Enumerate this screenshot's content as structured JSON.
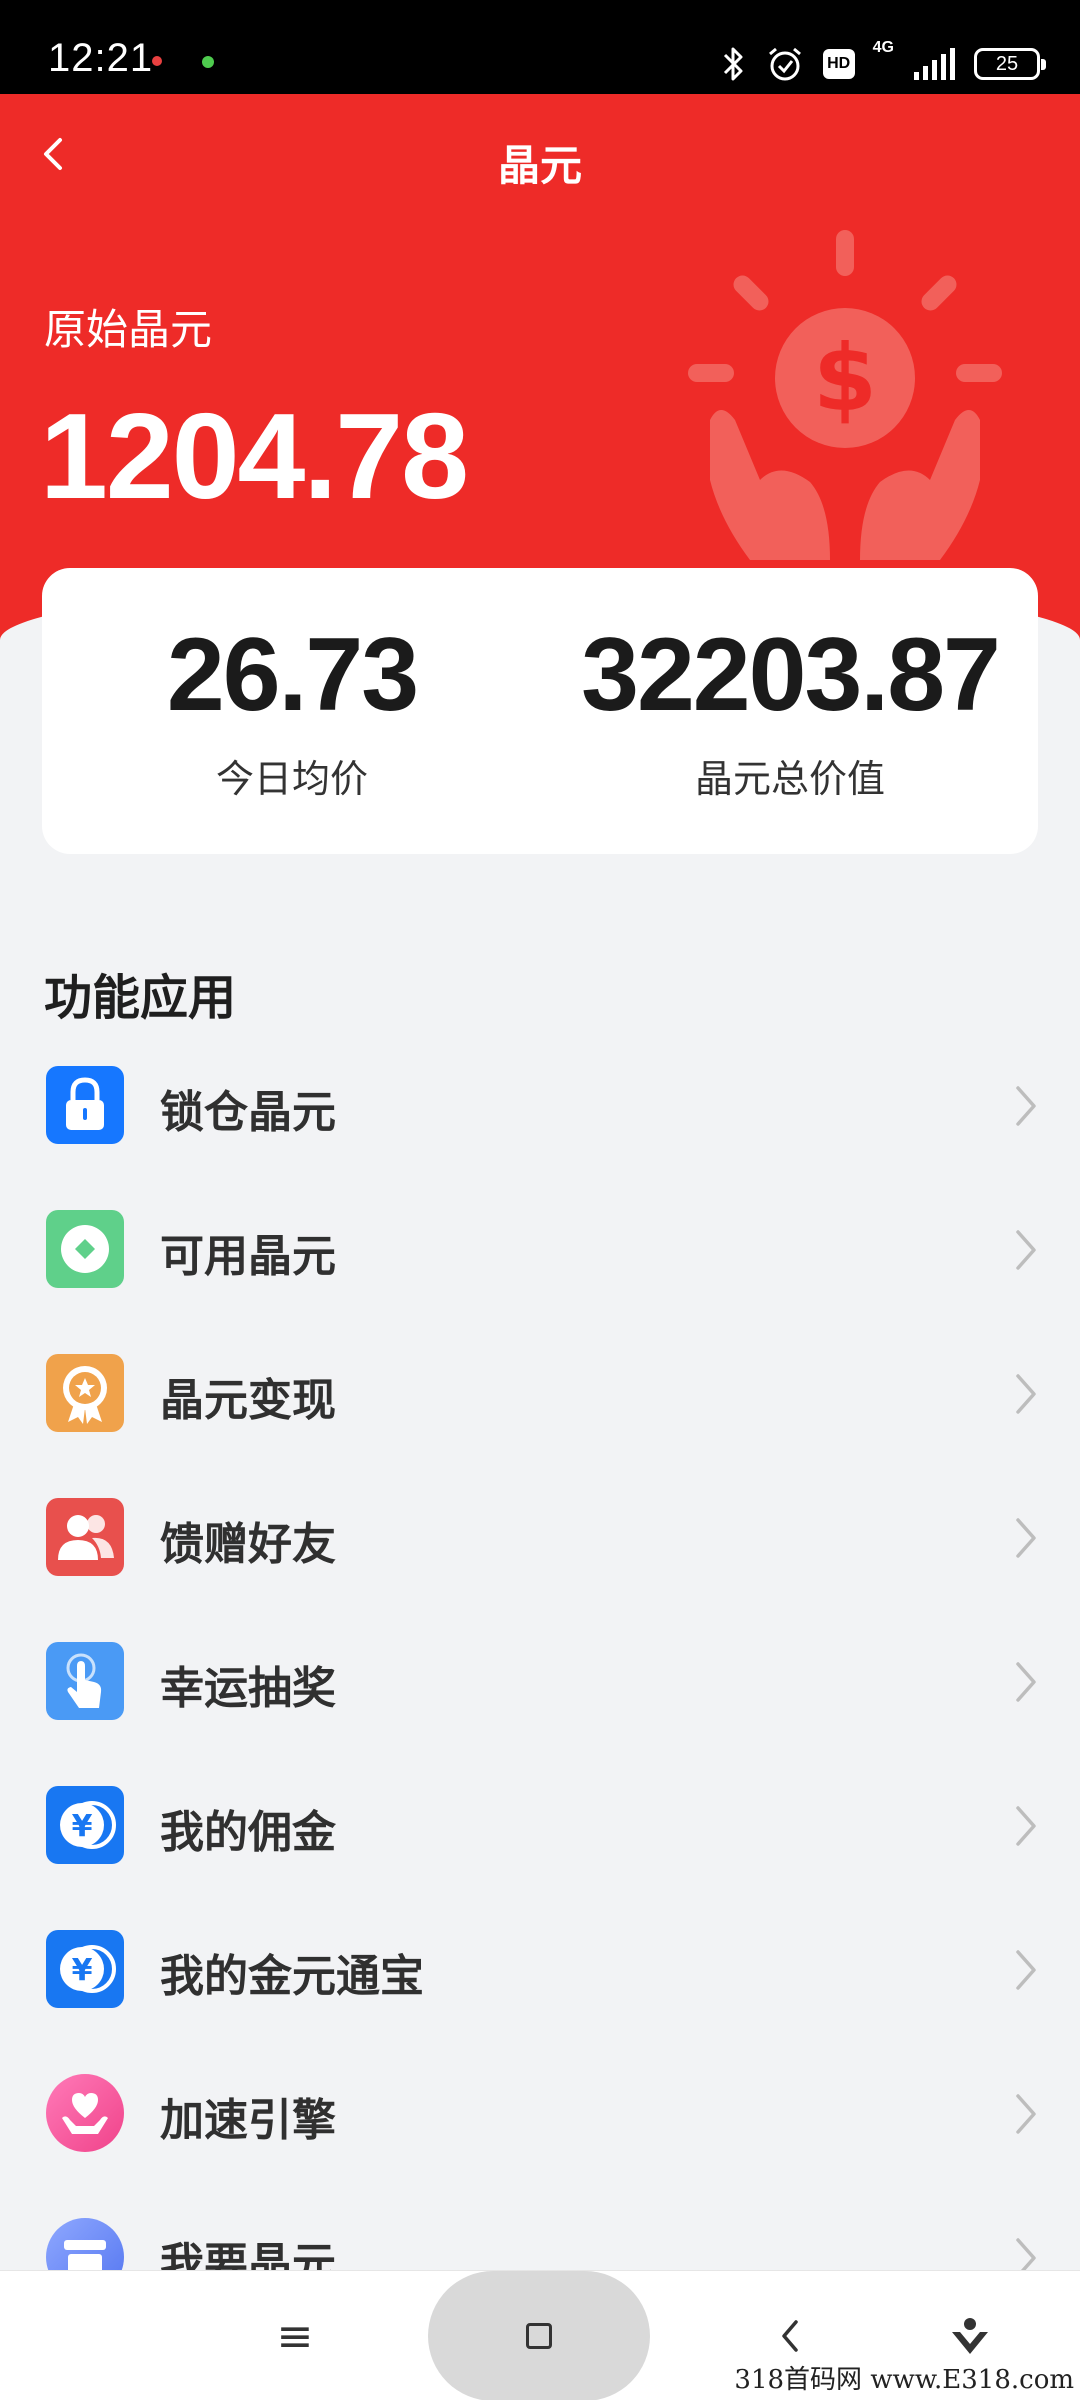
{
  "status_bar": {
    "time": "12:21",
    "network": "4G",
    "hd_badge": "HD",
    "battery": "25",
    "icons": [
      "bluetooth-icon",
      "alarm-icon",
      "hd-icon",
      "signal-icon",
      "battery-icon"
    ]
  },
  "header": {
    "title": "晶元",
    "back_icon": "chevron-left-icon"
  },
  "balance": {
    "label": "原始晶元",
    "value": "1204.78"
  },
  "stats": [
    {
      "value": "26.73",
      "label": "今日均价"
    },
    {
      "value": "32203.87",
      "label": "晶元总价值"
    }
  ],
  "features": {
    "title": "功能应用",
    "items": [
      {
        "label": "锁仓晶元",
        "icon": "lock-icon",
        "color": "#1677ff"
      },
      {
        "label": "可用晶元",
        "icon": "coin-diamond-icon",
        "color": "#5fd08a"
      },
      {
        "label": "晶元变现",
        "icon": "medal-icon",
        "color": "#f0a24b"
      },
      {
        "label": "馈赠好友",
        "icon": "friends-icon",
        "color": "#e8504d"
      },
      {
        "label": "幸运抽奖",
        "icon": "tap-icon",
        "color": "#4a9af5"
      },
      {
        "label": "我的佣金",
        "icon": "yuan-coin-icon",
        "color": "#1877f2"
      },
      {
        "label": "我的金元通宝",
        "icon": "yuan-coin-icon",
        "color": "#1877f2"
      },
      {
        "label": "加速引擎",
        "icon": "heart-hand-icon",
        "color": "#f25aa0"
      },
      {
        "label": "我要晶元",
        "icon": "store-icon",
        "color": "#6a8df5"
      }
    ]
  },
  "bottom_nav": {
    "menu_glyph": "≡",
    "items": [
      "menu-icon",
      "home-icon",
      "back-icon",
      "assistant-icon"
    ]
  },
  "watermark": "318首码网 www.E318.com",
  "colors": {
    "header_red": "#ee2b28",
    "background": "#f2f3f5",
    "card": "#ffffff"
  }
}
